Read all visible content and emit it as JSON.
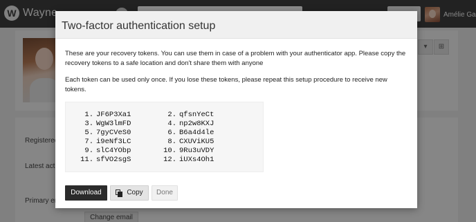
{
  "app": {
    "brand": "Wayne",
    "logo_letter": "W",
    "user_name": "Amélie Gaz"
  },
  "background": {
    "labels": {
      "registered": "Registered",
      "latest_activity": "Latest act",
      "primary_email": "Primary em"
    },
    "change_email_button": "Change email",
    "side_buttons": [
      "▾",
      "⊞"
    ]
  },
  "modal": {
    "title": "Two-factor authentication setup",
    "paragraph1": "These are your recovery tokens. You can use them in case of a problem with your authenticator app. Please copy the recovery tokens to a safe location and don't share them with anyone",
    "paragraph2": "Each token can be used only once. If you lose these tokens, please repeat this setup procedure to receive new tokens.",
    "tokens": [
      {
        "num": "1.",
        "code": "JF6P3Xa1"
      },
      {
        "num": "2.",
        "code": "qfsnYeCt"
      },
      {
        "num": "3.",
        "code": "WgW3lmFD"
      },
      {
        "num": "4.",
        "code": "np2w8KXJ"
      },
      {
        "num": "5.",
        "code": "7gyCVeS0"
      },
      {
        "num": "6.",
        "code": "B6a4d4le"
      },
      {
        "num": "7.",
        "code": "i9eNf3LC"
      },
      {
        "num": "8.",
        "code": "CXUViKU5"
      },
      {
        "num": "9.",
        "code": "slC4YObp"
      },
      {
        "num": "10.",
        "code": "9Ru3uVDY"
      },
      {
        "num": "11.",
        "code": "sfVO2sgS"
      },
      {
        "num": "12.",
        "code": "iUXs4Oh1"
      }
    ],
    "buttons": {
      "download": "Download",
      "copy": "Copy",
      "done": "Done"
    }
  }
}
